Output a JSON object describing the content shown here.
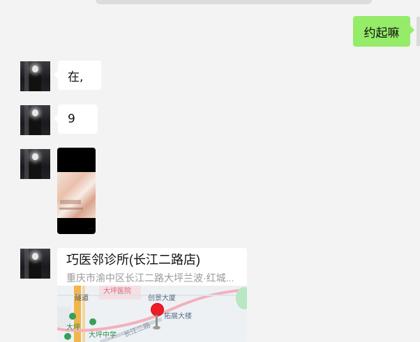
{
  "messages": {
    "outgoing_1": "约起嘛",
    "incoming_1": "在,",
    "incoming_2": "9",
    "image_corner": "· ·"
  },
  "location": {
    "title": "巧医邻诊所(长江二路店)",
    "address": "重庆市渝中区长江二路大坪兰波·红城...",
    "map_labels": {
      "hospital": "大坪医院",
      "building_1": "创景大厦",
      "building_2": "拓展大楼",
      "tunnel": "隧道",
      "daping": "大坪",
      "school": "大坪中学",
      "road": "长江二路"
    }
  },
  "colors": {
    "outgoing_bubble": "#95ec69",
    "incoming_bubble": "#ffffff",
    "background": "#f3f3f3",
    "pin": "#ee1c25"
  },
  "icons": {
    "avatar": "avatar-photo",
    "pin": "map-pin-icon"
  }
}
